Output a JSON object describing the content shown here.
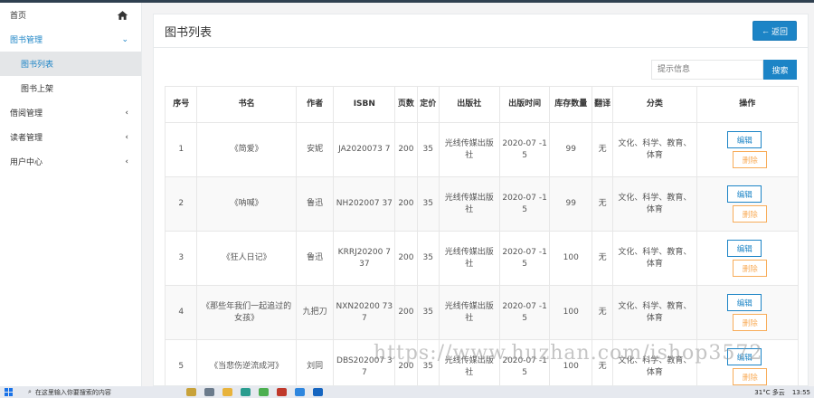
{
  "sidebar": {
    "items": [
      {
        "label": "首页",
        "icon": "home-icon"
      },
      {
        "label": "图书管理",
        "arrow": "⌄"
      },
      {
        "label": "图书列表"
      },
      {
        "label": "图书上架"
      },
      {
        "label": "借阅管理",
        "arrow": "‹"
      },
      {
        "label": "读者管理",
        "arrow": "‹"
      },
      {
        "label": "用户中心",
        "arrow": "‹"
      }
    ]
  },
  "page": {
    "title": "图书列表",
    "back_label": "返回",
    "search_placeholder": "提示信息",
    "search_label": "搜索"
  },
  "table": {
    "headers": [
      "序号",
      "书名",
      "作者",
      "ISBN",
      "页数",
      "定价",
      "出版社",
      "出版时间",
      "库存数量",
      "翻译",
      "分类",
      "操作"
    ],
    "edit_label": "编辑",
    "delete_label": "删除",
    "rows": [
      {
        "no": "1",
        "title": "《简爱》",
        "author": "安妮",
        "isbn": "JA2020073 7",
        "pages": "200",
        "price": "35",
        "publisher": "光线传媒出版社",
        "date": "2020-07 -15",
        "stock": "99",
        "translate": "无",
        "category": "文化、科学、教育、体育"
      },
      {
        "no": "2",
        "title": "《呐喊》",
        "author": "鲁迅",
        "isbn": "NH202007 37",
        "pages": "200",
        "price": "35",
        "publisher": "光线传媒出版社",
        "date": "2020-07 -15",
        "stock": "99",
        "translate": "无",
        "category": "文化、科学、教育、体育"
      },
      {
        "no": "3",
        "title": "《狂人日记》",
        "author": "鲁迅",
        "isbn": "KRRJ20200 737",
        "pages": "200",
        "price": "35",
        "publisher": "光线传媒出版社",
        "date": "2020-07 -15",
        "stock": "100",
        "translate": "无",
        "category": "文化、科学、教育、体育"
      },
      {
        "no": "4",
        "title": "《那些年我们一起追过的女孩》",
        "author": "九把刀",
        "isbn": "NXN20200 737",
        "pages": "200",
        "price": "35",
        "publisher": "光线传媒出版社",
        "date": "2020-07 -15",
        "stock": "100",
        "translate": "无",
        "category": "文化、科学、教育、体育"
      },
      {
        "no": "5",
        "title": "《当悲伤逆流成河》",
        "author": "刘同",
        "isbn": "DBS202007 37",
        "pages": "200",
        "price": "35",
        "publisher": "光线传媒出版社",
        "date": "2020-07 -15",
        "stock": "100",
        "translate": "无",
        "category": "文化、科学、教育、体育"
      }
    ]
  },
  "watermark": "https://www.huzhan.com/ishop3572",
  "taskbar": {
    "search_text": "在这里输入你要搜索的内容",
    "weather": "31°C 多云",
    "clock": "13:55"
  },
  "colors": {
    "accent": "#1c84c6",
    "warning": "#f8ac59"
  }
}
